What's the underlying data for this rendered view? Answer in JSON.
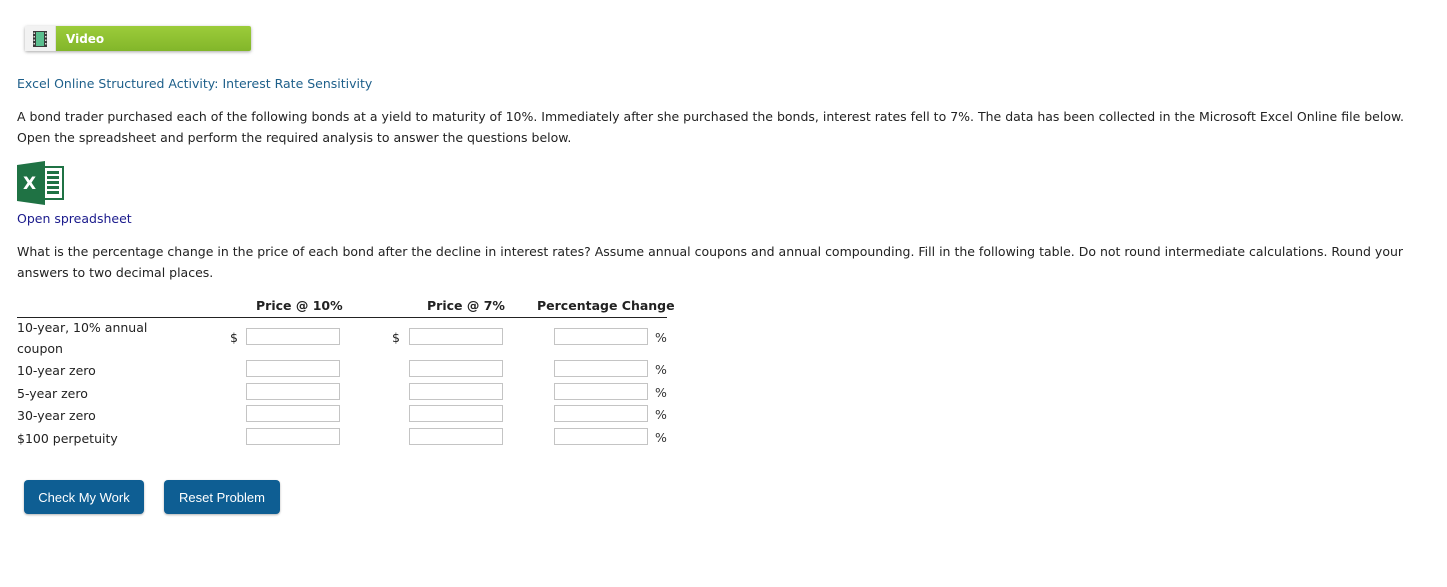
{
  "video_button": {
    "label": "Video",
    "icon": "film-icon"
  },
  "activity_title": "Excel Online Structured Activity: Interest Rate Sensitivity",
  "intro": "A bond trader purchased each of the following bonds at a yield to maturity of 10%. Immediately after she purchased the bonds, interest rates fell to 7%. The data has been collected in the Microsoft Excel Online file below. Open the spreadsheet and perform the required analysis to answer the questions below.",
  "spreadsheet": {
    "icon": "excel-icon",
    "link_label": "Open spreadsheet"
  },
  "question": "What is the percentage change in the price of each bond after the decline in interest rates? Assume annual coupons and annual compounding. Fill in the following table. Do not round intermediate calculations. Round your answers to two decimal places.",
  "table": {
    "columns": [
      "Price @ 10%",
      "Price @ 7%",
      "Percentage Change"
    ],
    "currency_symbol": "$",
    "percent_symbol": "%",
    "rows": [
      {
        "label_line1": "10-year, 10% annual",
        "label_line2": "coupon",
        "price_10": "",
        "price_7": "",
        "pct_change": ""
      },
      {
        "label": "10-year zero",
        "price_10": "",
        "price_7": "",
        "pct_change": ""
      },
      {
        "label": "5-year zero",
        "price_10": "",
        "price_7": "",
        "pct_change": ""
      },
      {
        "label": "30-year zero",
        "price_10": "",
        "price_7": "",
        "pct_change": ""
      },
      {
        "label": "$100 perpetuity",
        "price_10": "",
        "price_7": "",
        "pct_change": ""
      }
    ]
  },
  "buttons": {
    "check": "Check My Work",
    "reset": "Reset Problem"
  }
}
